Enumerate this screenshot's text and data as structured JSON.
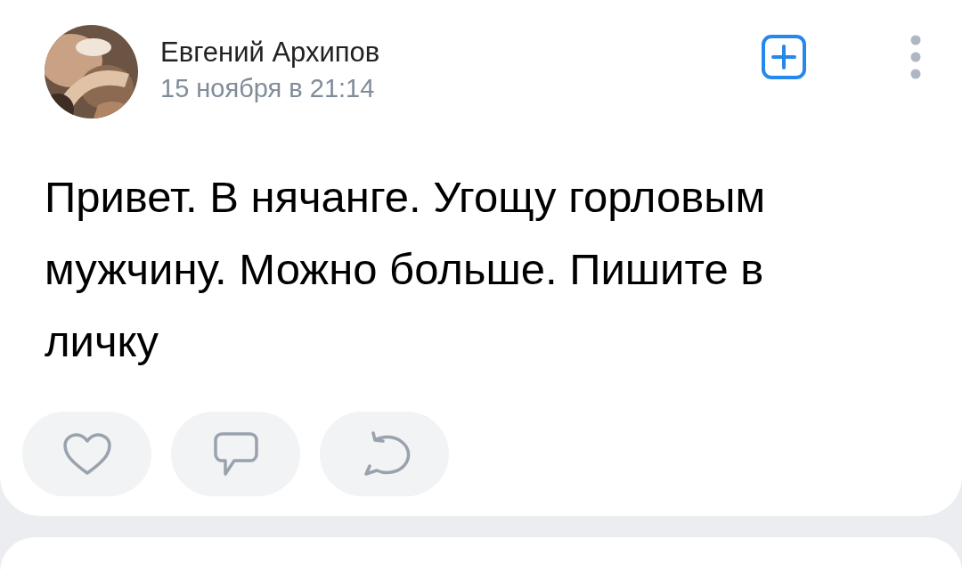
{
  "post": {
    "author": "Евгений Архипов",
    "date": "15 ноября в 21:14",
    "text": "Привет. В нячанге. Угощу горловым мужчину. Можно больше. Пишите в личку",
    "actions": [
      {
        "kind": "like"
      },
      {
        "kind": "comment"
      },
      {
        "kind": "share"
      }
    ]
  }
}
